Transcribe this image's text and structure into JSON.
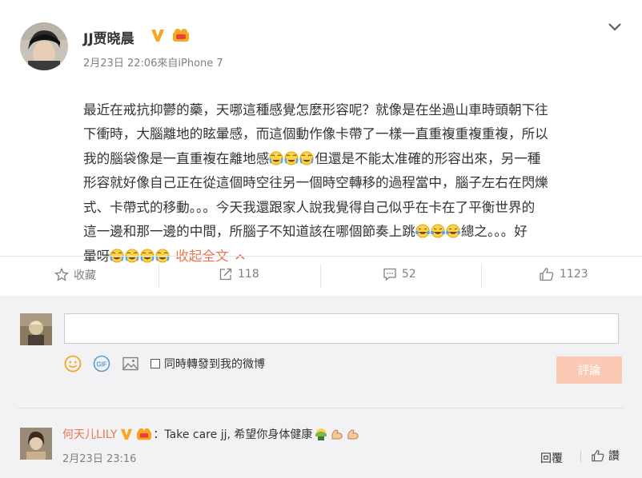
{
  "post": {
    "author": "JJ贾晓晨",
    "meta": "2月23日 22:06來自iPhone 7",
    "body_lines": [
      "最近在戒抗抑鬱的藥，天哪這種感覺怎麼形容呢？就像是在坐過山車時頭朝下往",
      "下衝時，大腦離地的眩暈感，而這個動作像卡帶了一樣一直重複重複重複，所以",
      "我的腦袋像是一直重複在離地感",
      "但還是不能太准確的形容出來，另一種",
      "形容就好像自己正在從這個時空往另一個時空轉移的過程當中，腦子左右在閃爍",
      "式、卡帶式的移動。。。今天我還跟家人說我覺得自己似乎在卡在了平衡世界的",
      "這一邊和那一邊的中間，所腦子不知道該在哪個節奏上跳",
      "總之。。。好",
      "暈呀"
    ],
    "collapse_label": "收起全文"
  },
  "actions": {
    "favorite": "收藏",
    "repost_count": "118",
    "comment_count": "52",
    "like_count": "1123"
  },
  "composer": {
    "placeholder": "",
    "also_repost_label": "同時轉發到我的微博",
    "submit_label": "評論"
  },
  "comment": {
    "author": "何天儿LILY",
    "separator": "：",
    "text": "Take care jj, 希望你身体健康",
    "time": "2月23日 23:16",
    "reply_label": "回覆",
    "like_label": "讚"
  },
  "colors": {
    "accent": "#eb7350",
    "verified": "#f5a623",
    "submit_bg": "#fbcab4",
    "panel_bg": "#f2f2f5"
  },
  "icons": [
    "verified-v-icon",
    "level-badge-icon",
    "chevron-down-icon",
    "cry-laugh-emoji",
    "laugh-tears-emoji",
    "star-icon",
    "repost-icon",
    "comment-icon",
    "thumbs-up-icon",
    "smile-icon",
    "gif-icon",
    "image-icon",
    "facepalm-emoji",
    "muscle-emoji"
  ]
}
